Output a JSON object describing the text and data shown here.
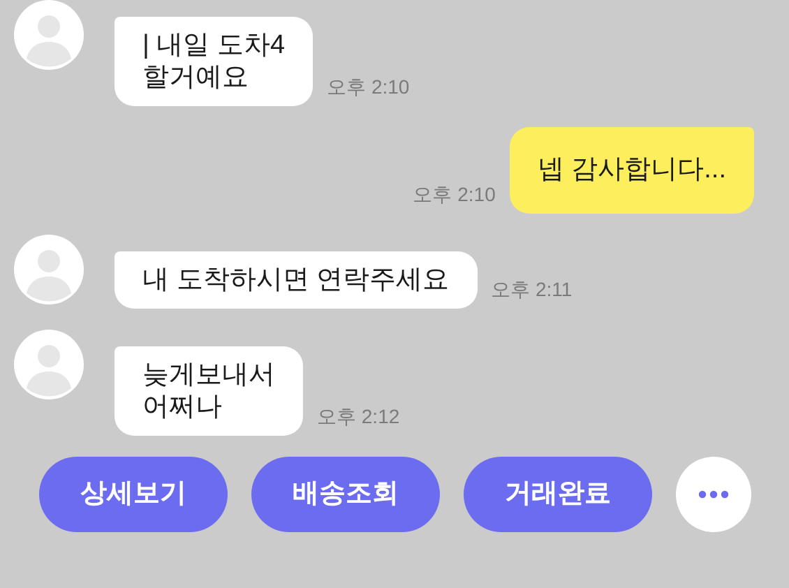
{
  "messages": [
    {
      "kind": "incoming",
      "lines": [
        "| 내일 도차4",
        "할거예요"
      ],
      "time": "오후 2:10"
    },
    {
      "kind": "outgoing",
      "lines": [
        "넵 감사합니다..."
      ],
      "time": "오후 2:10"
    },
    {
      "kind": "incoming",
      "lines": [
        "내 도착하시면 연락주세요"
      ],
      "time": "오후 2:11"
    },
    {
      "kind": "incoming",
      "lines": [
        "늦게보내서",
        "어쩌나"
      ],
      "time": "오후 2:12"
    }
  ],
  "actions": [
    "상세보기",
    "배송조회",
    "거래완료"
  ]
}
